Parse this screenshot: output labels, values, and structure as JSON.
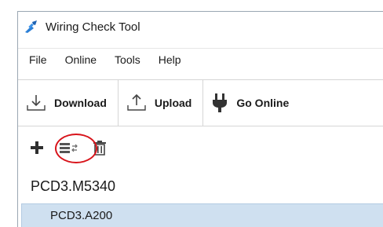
{
  "window": {
    "title": "Wiring Check Tool",
    "icon": "wiring-tool-icon"
  },
  "menubar": {
    "items": [
      {
        "label": "File"
      },
      {
        "label": "Online"
      },
      {
        "label": "Tools"
      },
      {
        "label": "Help"
      }
    ]
  },
  "toolbar": {
    "buttons": [
      {
        "label": "Download",
        "icon": "download-icon"
      },
      {
        "label": "Upload",
        "icon": "upload-icon"
      },
      {
        "label": "Go Online",
        "icon": "plug-icon"
      }
    ]
  },
  "small_toolbar": {
    "icons": [
      "add-icon",
      "modules-swap-icon",
      "delete-icon"
    ],
    "highlight_color": "#d8141b"
  },
  "tree": {
    "root": "PCD3.M5340",
    "children": [
      {
        "label": "PCD3.A200",
        "selected": true
      }
    ],
    "selection_color": "#cfe0f0"
  }
}
